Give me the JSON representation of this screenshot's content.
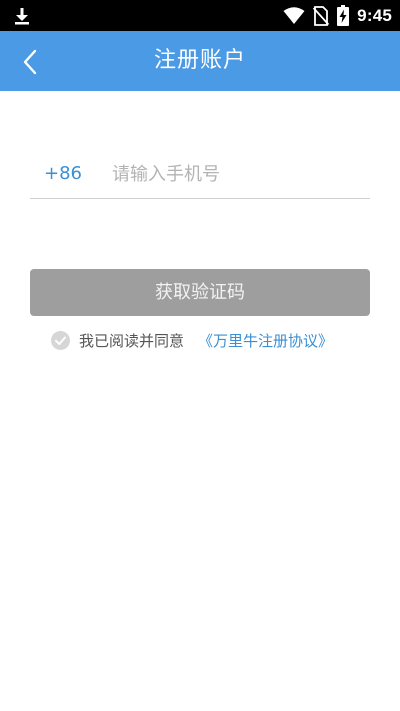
{
  "status_bar": {
    "time": "9:45",
    "icons": [
      "download-icon",
      "wifi-icon",
      "no-sim-icon",
      "battery-charging-icon"
    ]
  },
  "app_bar": {
    "back_icon": "chevron-left-icon",
    "title": "注册账户",
    "background_color": "#4a9ae5"
  },
  "form": {
    "country_code": "+86",
    "phone_value": "",
    "phone_placeholder": "请输入手机号",
    "get_code_label": "获取验证码"
  },
  "agreement": {
    "checked": false,
    "text": "我已阅读并同意",
    "link_text": "《万里牛注册协议》"
  },
  "colors": {
    "accent": "#3a8fd6",
    "button_disabled": "#9e9e9e"
  }
}
